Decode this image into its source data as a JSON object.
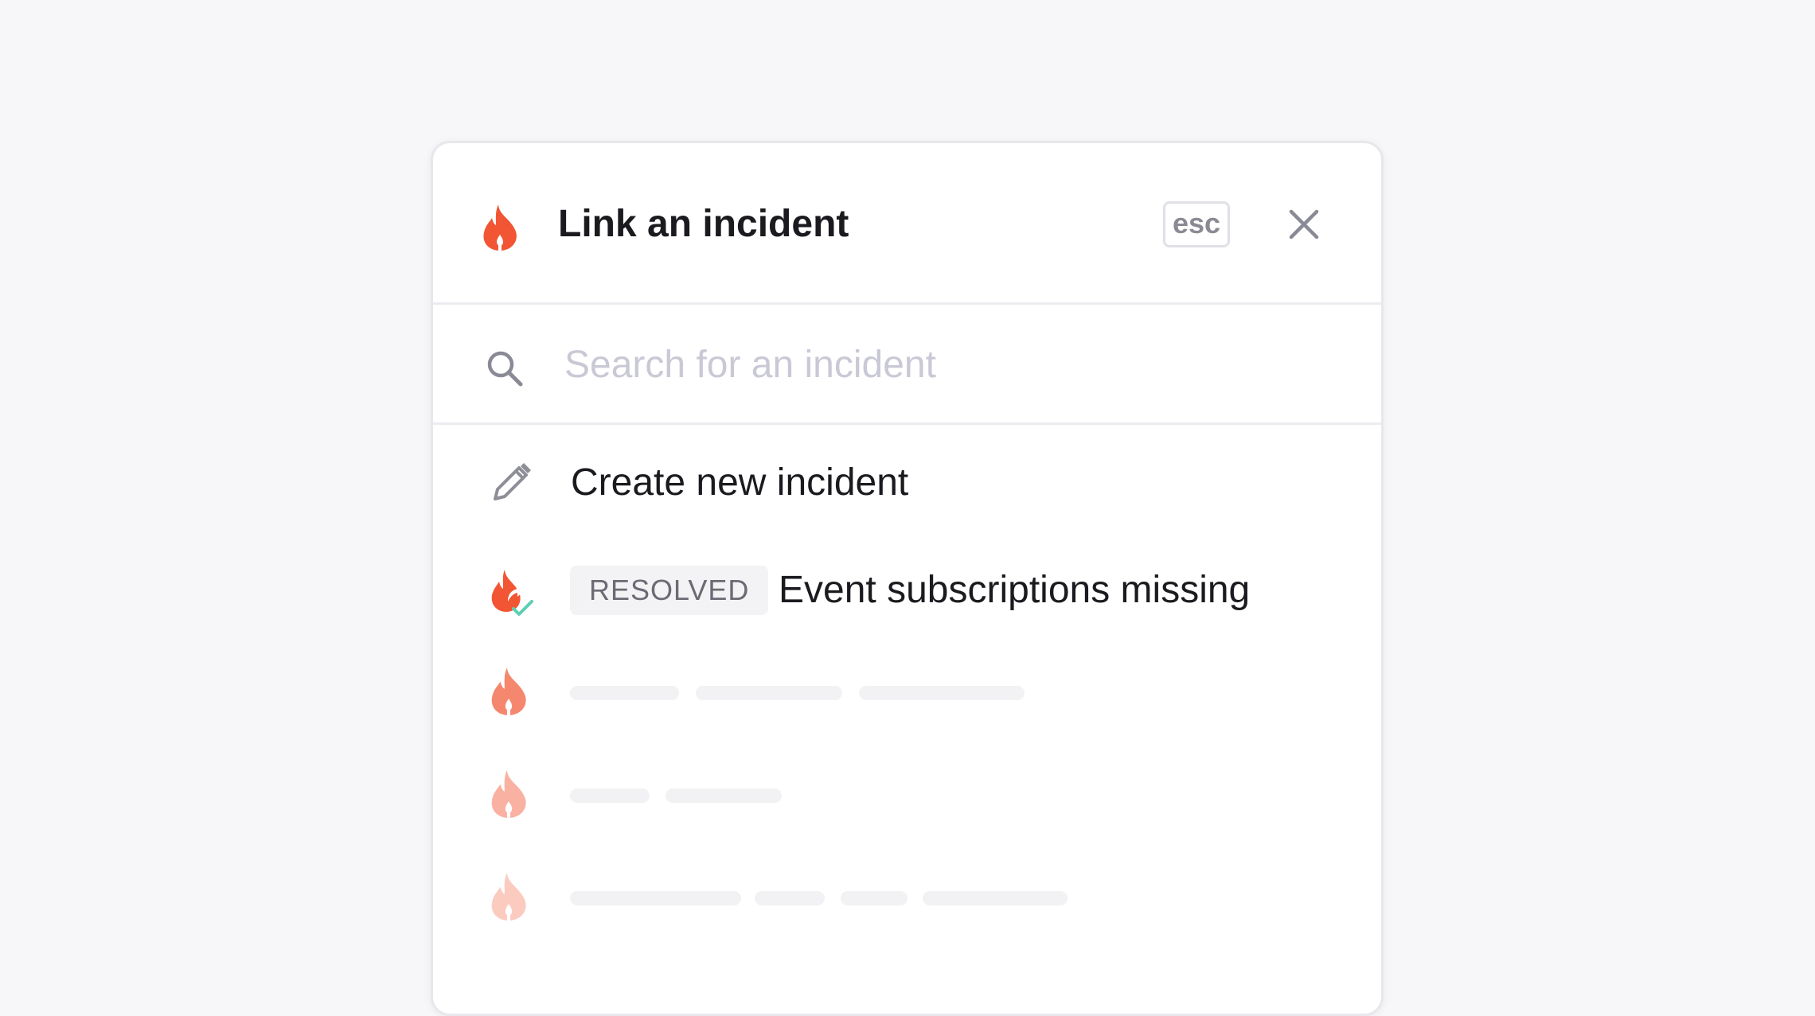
{
  "dialog": {
    "title": "Link an incident",
    "title_icon": "fire-icon",
    "esc_key_label": "esc",
    "close_icon": "close-icon"
  },
  "search": {
    "icon": "search-icon",
    "placeholder": "Search for an incident",
    "value": ""
  },
  "list": {
    "create_item": {
      "icon": "pencil-icon",
      "label": "Create new incident"
    },
    "incidents": [
      {
        "icon": "resolved-fire-icon",
        "status": "RESOLVED",
        "title": "Event subscriptions missing"
      }
    ],
    "loading_placeholders": [
      {
        "icon": "fire-icon"
      },
      {
        "icon": "fire-icon"
      },
      {
        "icon": "fire-icon"
      }
    ]
  },
  "colors": {
    "brand_fire": "#f25533",
    "resolved_check": "#5ccfb4",
    "page_background": "#f7f7f9",
    "skeleton": "#f2f2f4"
  }
}
